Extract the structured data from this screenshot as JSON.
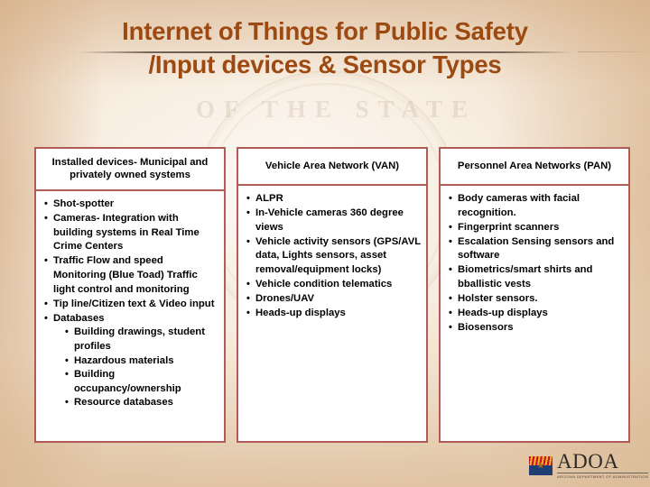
{
  "slide": {
    "title_line1": "Internet of Things for Public Safety",
    "title_line2": "/Input devices & Sensor Types",
    "watermark_text": "OF THE STATE",
    "accent_title_color": "#9c4a12",
    "table_border_color": "#b05b55",
    "bullet_glyph": "•"
  },
  "columns": [
    {
      "header": "Installed devices- Municipal and privately owned systems",
      "items": [
        {
          "text": "Shot-spotter",
          "children": []
        },
        {
          "text": "Cameras- Integration with building systems in Real Time Crime Centers",
          "children": []
        },
        {
          "text": "Traffic Flow and speed Monitoring (Blue Toad) Traffic light control and monitoring",
          "children": []
        },
        {
          "text": "Tip line/Citizen text & Video input",
          "children": []
        },
        {
          "text": "Databases",
          "children": [
            "Building drawings, student profiles",
            "Hazardous materials",
            "Building occupancy/ownership",
            "Resource databases"
          ]
        }
      ]
    },
    {
      "header": "Vehicle Area Network (VAN)",
      "items": [
        {
          "text": "ALPR",
          "children": []
        },
        {
          "text": "In-Vehicle cameras 360 degree views",
          "children": []
        },
        {
          "text": "Vehicle activity sensors (GPS/AVL data, Lights sensors, asset removal/equipment locks)",
          "children": []
        },
        {
          "text": "Vehicle condition telematics",
          "children": []
        },
        {
          "text": "Drones/UAV",
          "children": []
        },
        {
          "text": "Heads-up displays",
          "children": []
        }
      ]
    },
    {
      "header": "Personnel Area Networks (PAN)",
      "items": [
        {
          "text": "Body cameras with facial recognition.",
          "children": []
        },
        {
          "text": "Fingerprint scanners",
          "children": []
        },
        {
          "text": "Escalation Sensing sensors and software",
          "children": []
        },
        {
          "text": "Biometrics/smart shirts and bballistic vests",
          "children": []
        },
        {
          "text": "Holster sensors.",
          "children": []
        },
        {
          "text": "Heads-up displays",
          "children": []
        },
        {
          "text": "Biosensors",
          "children": []
        }
      ]
    }
  ],
  "logo": {
    "wordmark": "ADOA",
    "subtitle": "ARIZONA DEPARTMENT OF ADMINISTRATION",
    "flag_name": "arizona-flag-icon"
  }
}
